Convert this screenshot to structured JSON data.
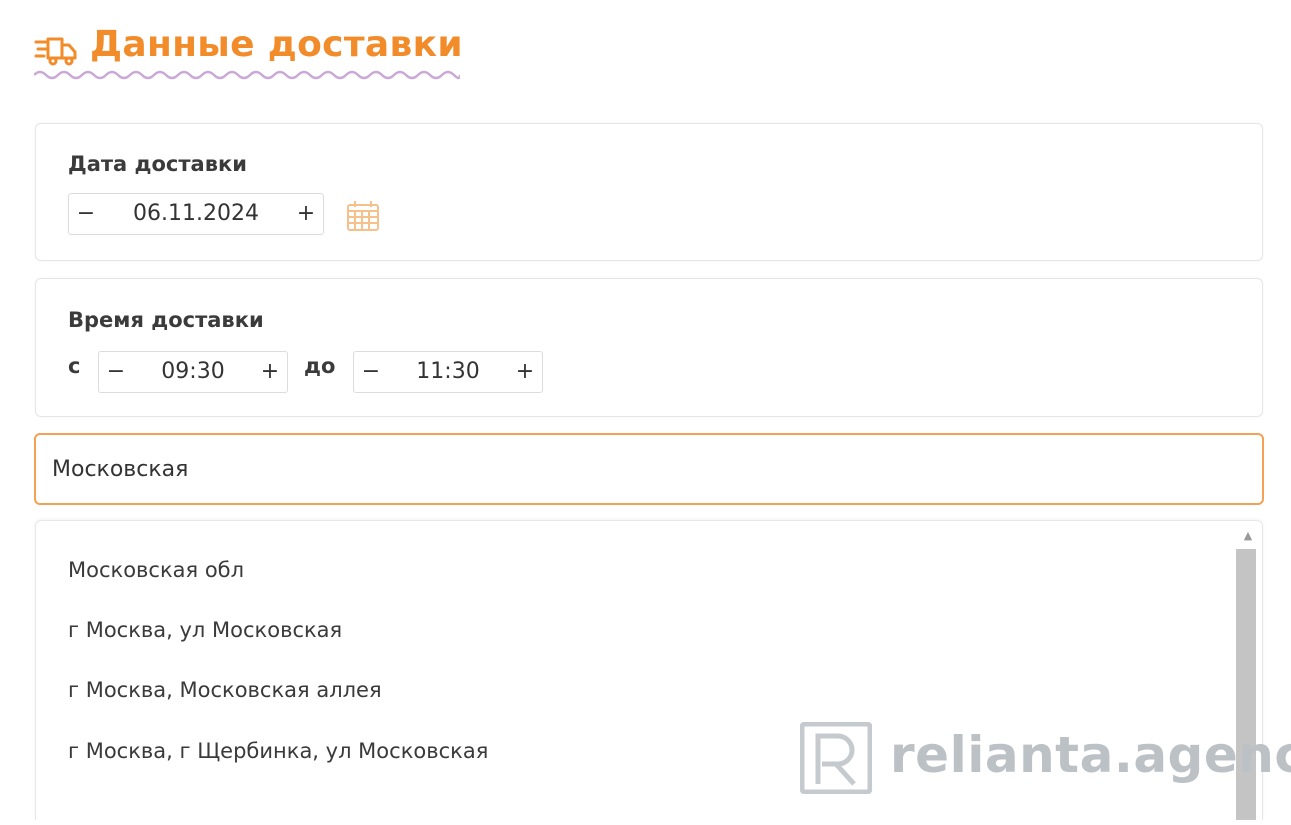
{
  "header": {
    "title": "Данные доставки",
    "icon": "truck-icon"
  },
  "colors": {
    "accent": "#f28c2a",
    "wave": "#c9a8d6",
    "input_focus": "#f4a155",
    "calendar": "#f6c08b",
    "scrollbar": "#c4c4c4",
    "watermark": "#bcc1c6"
  },
  "delivery_date": {
    "label": "Дата доставки",
    "value": "06.11.2024",
    "minus": "−",
    "plus": "+"
  },
  "delivery_time": {
    "label": "Время доставки",
    "from_label": "с",
    "to_label": "до",
    "from": {
      "value": "09:30",
      "minus": "−",
      "plus": "+"
    },
    "to": {
      "value": "11:30",
      "minus": "−",
      "plus": "+"
    }
  },
  "address": {
    "value": "Московская"
  },
  "suggestions": [
    "Московская обл",
    "г Москва, ул Московская",
    "г Москва, Московская аллея",
    "г Москва, г Щербинка, ул Московская"
  ],
  "scroll_up_glyph": "▲",
  "watermark": {
    "text": "relianta.agency"
  }
}
